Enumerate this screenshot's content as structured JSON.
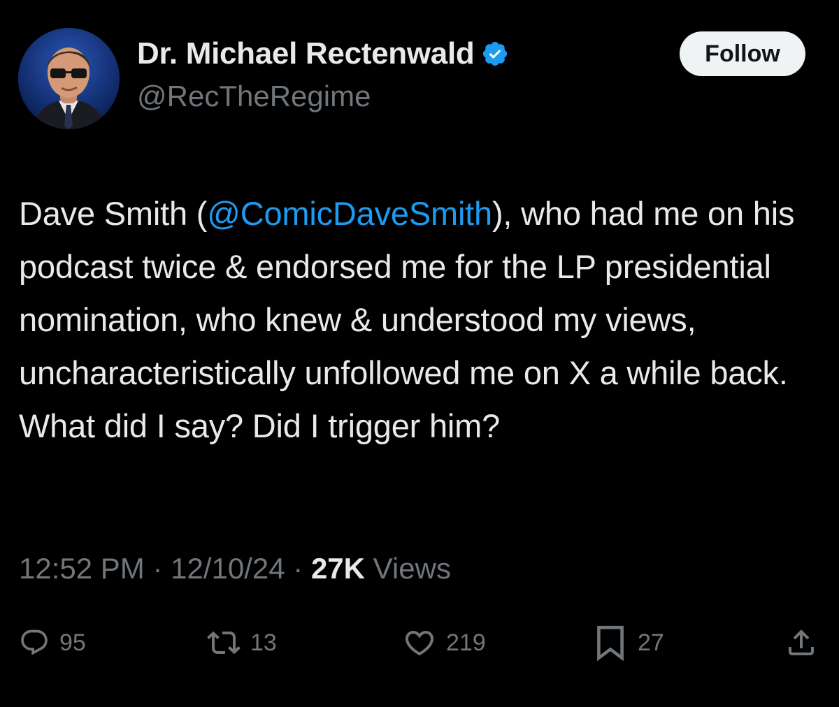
{
  "author": {
    "display_name": "Dr. Michael Rectenwald",
    "handle": "@RecTheRegime",
    "verified": true
  },
  "follow_label": "Follow",
  "tweet": {
    "text_before": "Dave Smith (",
    "mention": "@ComicDaveSmith",
    "text_after": "), who had me on his podcast twice & endorsed me for the LP presidential nomination, who knew & understood my views, uncharacteristically unfollowed me on X a while back. What did I say? Did I trigger him?"
  },
  "meta": {
    "time": "12:52 PM",
    "separator": " · ",
    "date": "12/10/24",
    "views_count": "27K",
    "views_label": " Views"
  },
  "actions": {
    "replies": "95",
    "reposts": "13",
    "likes": "219",
    "bookmarks": "27"
  },
  "colors": {
    "background": "#000000",
    "text_primary": "#e7e9ea",
    "text_secondary": "#71767b",
    "accent": "#1d9bf0",
    "follow_bg": "#eff3f4"
  },
  "icons": {
    "verified": "verified-badge-icon",
    "reply": "reply-bubble-icon",
    "repost": "repost-arrows-icon",
    "like": "heart-icon",
    "bookmark": "bookmark-icon",
    "share": "share-upload-icon"
  }
}
